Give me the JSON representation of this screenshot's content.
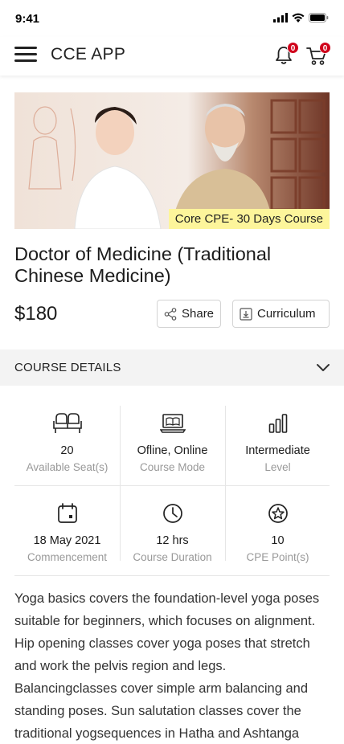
{
  "status_bar": {
    "time": "9:41"
  },
  "header": {
    "title": "CCE APP",
    "notifications_count": "0",
    "cart_count": "0"
  },
  "hero": {
    "tag": "Core CPE- 30 Days Course"
  },
  "course": {
    "title": "Doctor of Medicine (Traditional Chinese Medicine)",
    "price": "$180",
    "share_label": "Share",
    "curriculum_label": "Curriculum"
  },
  "details": {
    "header_label": "COURSE DETAILS",
    "items": [
      {
        "icon": "seat-icon",
        "value": "20",
        "label": "Available Seat(s)"
      },
      {
        "icon": "laptop-book-icon",
        "value": "Ofline, Online",
        "label": "Course Mode"
      },
      {
        "icon": "bar-level-icon",
        "value": "Intermediate",
        "label": "Level"
      },
      {
        "icon": "calendar-icon",
        "value": "18 May 2021",
        "label": "Commencement"
      },
      {
        "icon": "clock-icon",
        "value": "12 hrs",
        "label": "Course Duration"
      },
      {
        "icon": "star-circle-icon",
        "value": "10",
        "label": "CPE Point(s)"
      }
    ]
  },
  "description": "Yoga basics covers the foundation-level yoga poses suitable for beginners, which focuses on alignment. Hip opening classes cover yoga poses that stretch and work the pelvis region and legs. Balancingclasses cover simple arm balancing and standing poses. Sun salutation classes cover the traditional yogsequences in Hatha and Ashtanga"
}
